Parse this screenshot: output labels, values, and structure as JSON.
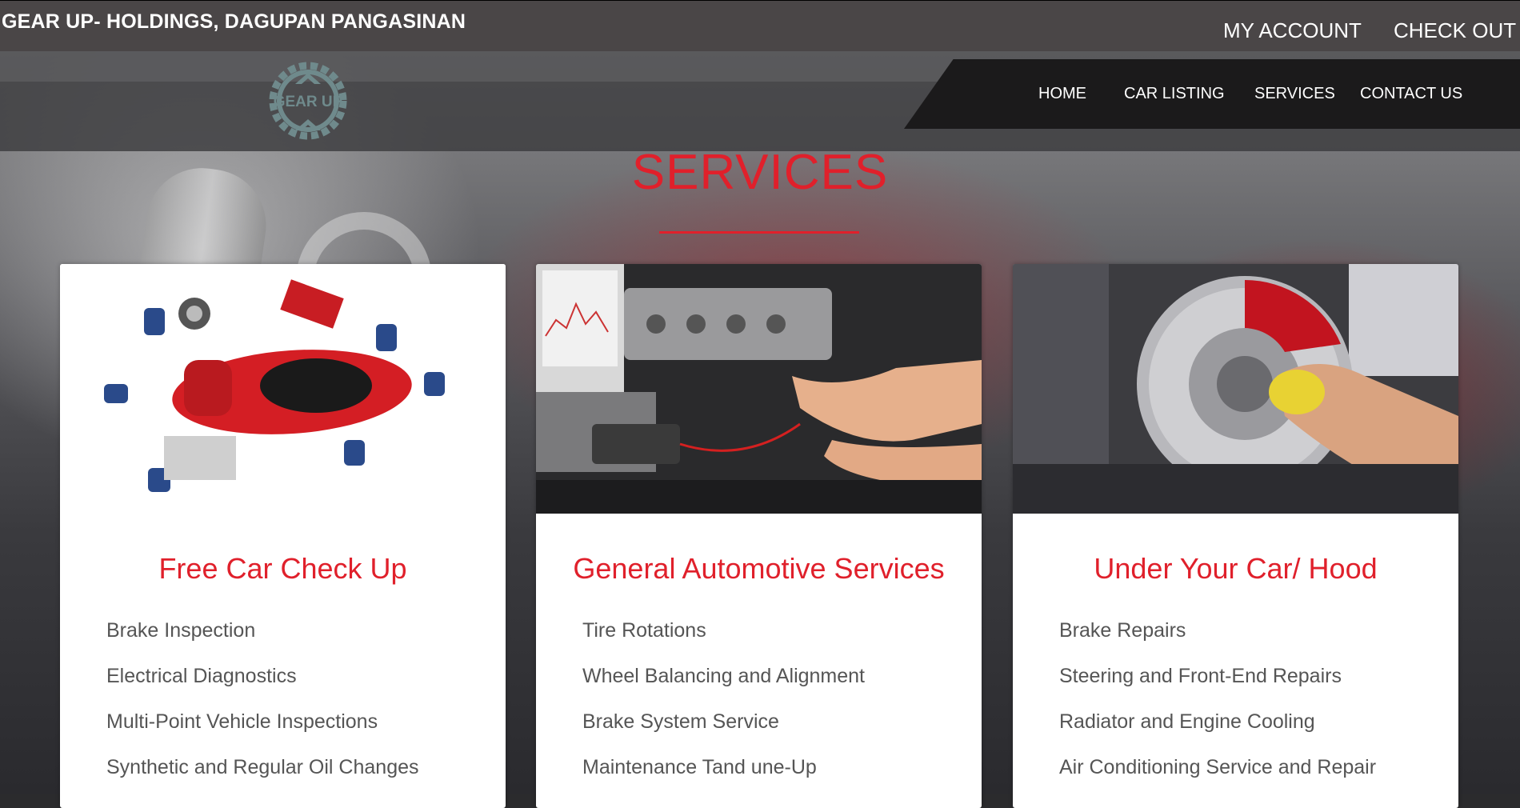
{
  "header": {
    "site_title": "GEAR UP- HOLDINGS, DAGUPAN PANGASINAN",
    "my_account": "MY ACCOUNT",
    "check_out": "CHECK OUT",
    "logo_text": "GEAR UP"
  },
  "nav": {
    "items": [
      {
        "label": "HOME"
      },
      {
        "label": "CAR LISTING"
      },
      {
        "label": "SERVICES"
      },
      {
        "label": "CONTACT US"
      }
    ]
  },
  "section": {
    "title": "SERVICES"
  },
  "cards": [
    {
      "title": "Free Car Check Up",
      "items": [
        "Brake Inspection",
        "Electrical Diagnostics",
        "Multi-Point Vehicle Inspections",
        "Synthetic and Regular Oil Changes"
      ]
    },
    {
      "title": "General Automotive Services",
      "items": [
        "Tire Rotations",
        "Wheel Balancing and Alignment",
        "Brake System Service",
        "Maintenance Tand une-Up"
      ]
    },
    {
      "title": "Under Your Car/ Hood",
      "items": [
        "Brake Repairs",
        "Steering and Front-End Repairs",
        "Radiator and Engine Cooling",
        "Air Conditioning Service and Repair"
      ]
    }
  ],
  "colors": {
    "accent": "#e0202b",
    "topbar": "#4a4647",
    "nav_bg": "#1b1a1b"
  }
}
